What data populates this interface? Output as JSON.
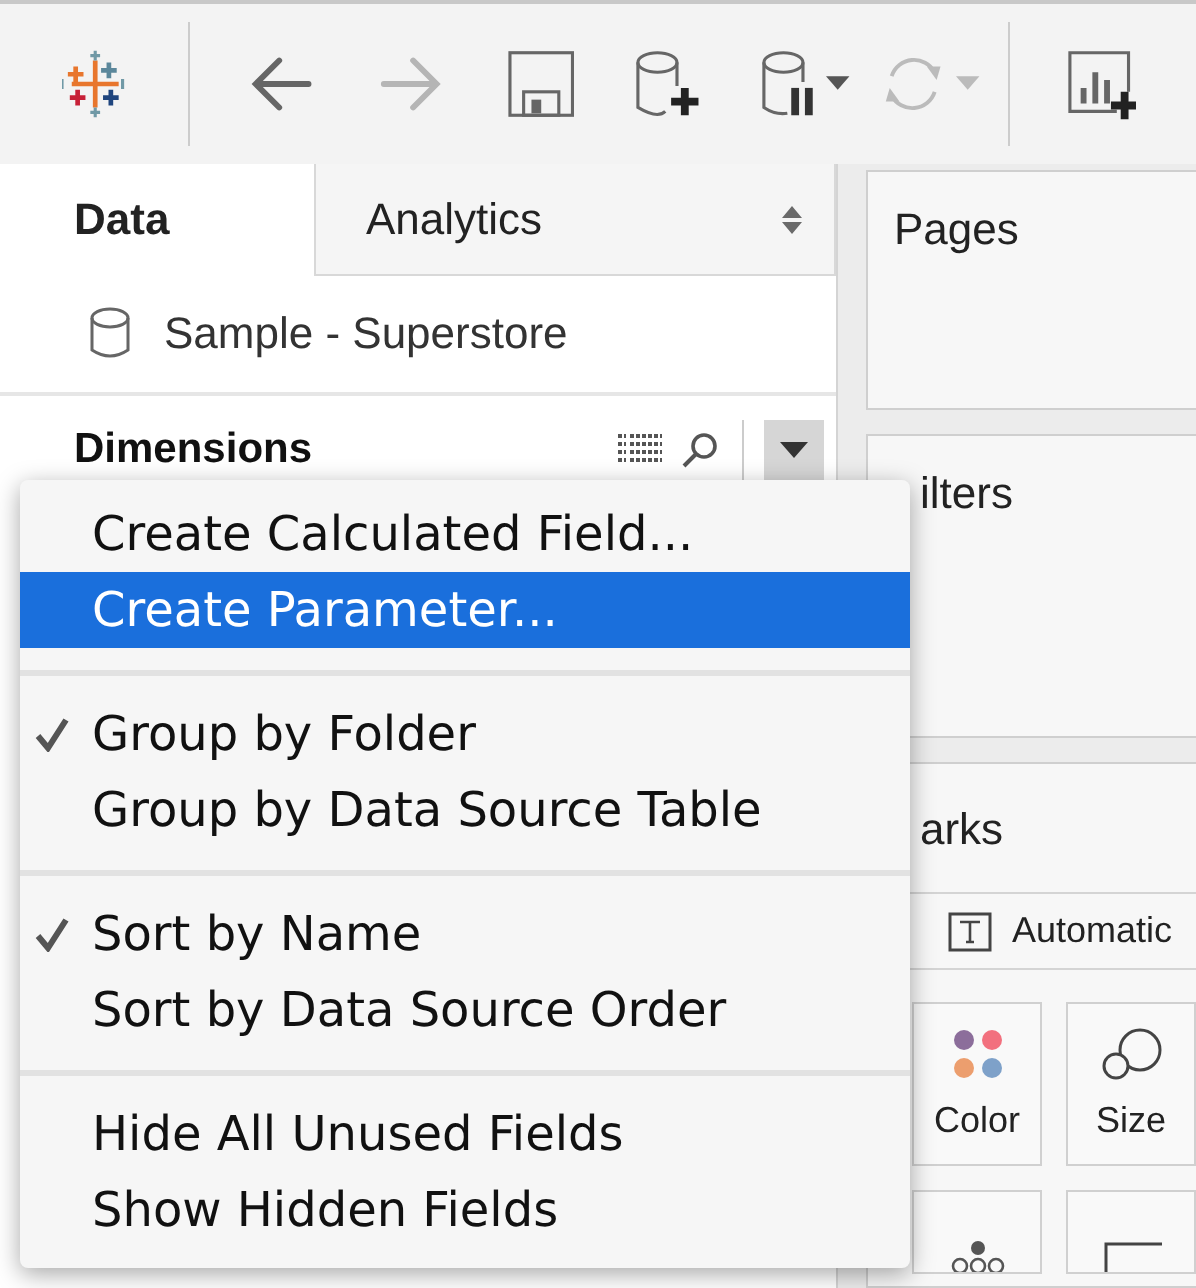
{
  "toolbar": {
    "back_disabled": false,
    "forward_disabled": true,
    "refresh_disabled": true
  },
  "data_pane": {
    "tabs": [
      {
        "label": "Data",
        "selected": true
      },
      {
        "label": "Analytics",
        "selected": false
      }
    ],
    "data_source": "Sample - Superstore",
    "section_title": "Dimensions"
  },
  "menu": {
    "groups": [
      [
        {
          "label": "Create Calculated Field...",
          "checked": false,
          "selected": false
        },
        {
          "label": "Create Parameter...",
          "checked": false,
          "selected": true
        }
      ],
      [
        {
          "label": "Group by Folder",
          "checked": true,
          "selected": false
        },
        {
          "label": "Group by Data Source Table",
          "checked": false,
          "selected": false
        }
      ],
      [
        {
          "label": "Sort by Name",
          "checked": true,
          "selected": false
        },
        {
          "label": "Sort by Data Source Order",
          "checked": false,
          "selected": false
        }
      ],
      [
        {
          "label": "Hide All Unused Fields",
          "checked": false,
          "selected": false
        },
        {
          "label": "Show Hidden Fields",
          "checked": false,
          "selected": false
        }
      ]
    ]
  },
  "shelves": {
    "pages": "Pages",
    "filters": "ilters",
    "marks": {
      "title": "arks",
      "mark_type": "Automatic",
      "buttons": [
        {
          "label": "Color",
          "kind": "color"
        },
        {
          "label": "Size",
          "kind": "size"
        }
      ]
    }
  }
}
